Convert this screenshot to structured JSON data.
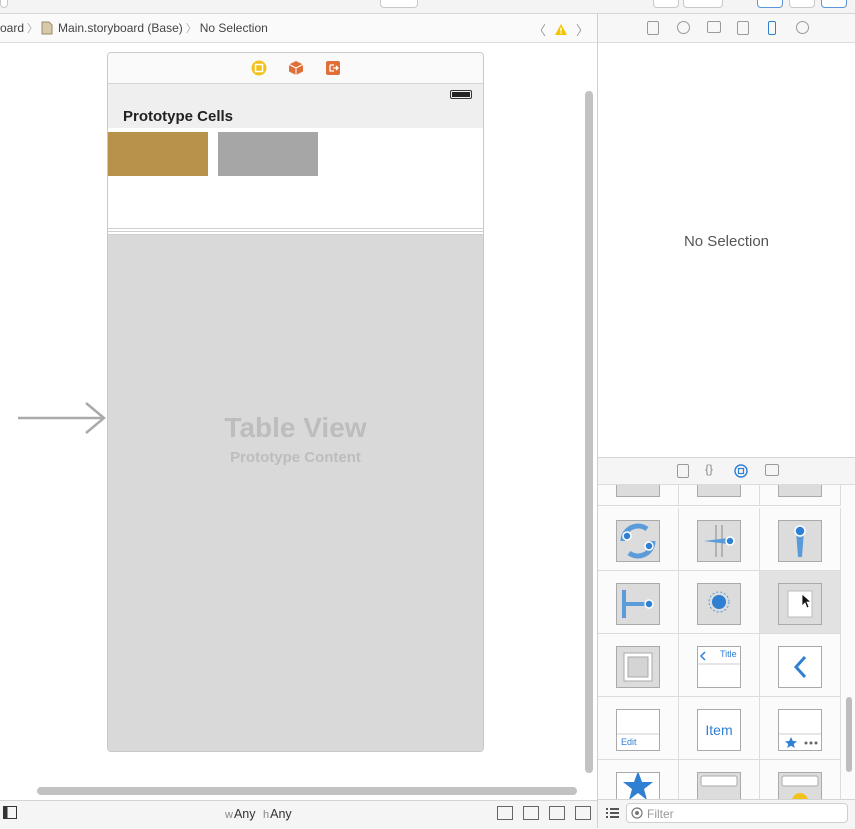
{
  "jumpbar": {
    "crumbs": [
      "oard",
      "Main.storyboard (Base)",
      "No Selection"
    ],
    "warning_color": "#f5c400"
  },
  "canvas": {
    "prototype_cells_title": "Prototype Cells",
    "table_view_title": "Table View",
    "table_view_subtitle": "Prototype Content",
    "swatch_colors": [
      "#b8924a",
      "#a6a6a6"
    ]
  },
  "bottombar": {
    "w_key": "w",
    "w_value": "Any",
    "h_key": "h",
    "h_value": "Any"
  },
  "inspector": {
    "empty_label": "No Selection"
  },
  "library": {
    "items": [
      {
        "icon": "page-view-controller-icon"
      },
      {
        "icon": "slider-icon"
      },
      {
        "icon": "stepper-icon"
      },
      {
        "icon": "pan-gesture-icon"
      },
      {
        "icon": "pinch-gesture-icon"
      },
      {
        "icon": "rotation-gesture-icon"
      },
      {
        "icon": "screen-edge-pan-icon"
      },
      {
        "icon": "long-press-icon"
      },
      {
        "icon": "custom-gesture-icon"
      },
      {
        "icon": "view-icon"
      },
      {
        "icon": "navigation-bar-icon",
        "label": "Title"
      },
      {
        "icon": "back-chevron-icon"
      },
      {
        "icon": "toolbar-icon",
        "label": "Edit"
      },
      {
        "icon": "bar-button-item-icon",
        "label": "Item"
      },
      {
        "icon": "tab-bar-icon"
      },
      {
        "icon": "tab-bar-item-icon"
      },
      {
        "icon": "search-bar-icon"
      },
      {
        "icon": "search-display-icon"
      }
    ],
    "filter_placeholder": "Filter"
  },
  "colors": {
    "accent_blue": "#2f7fd3",
    "dock_yellow": "#f3c21a",
    "dock_orange": "#e0703a"
  }
}
